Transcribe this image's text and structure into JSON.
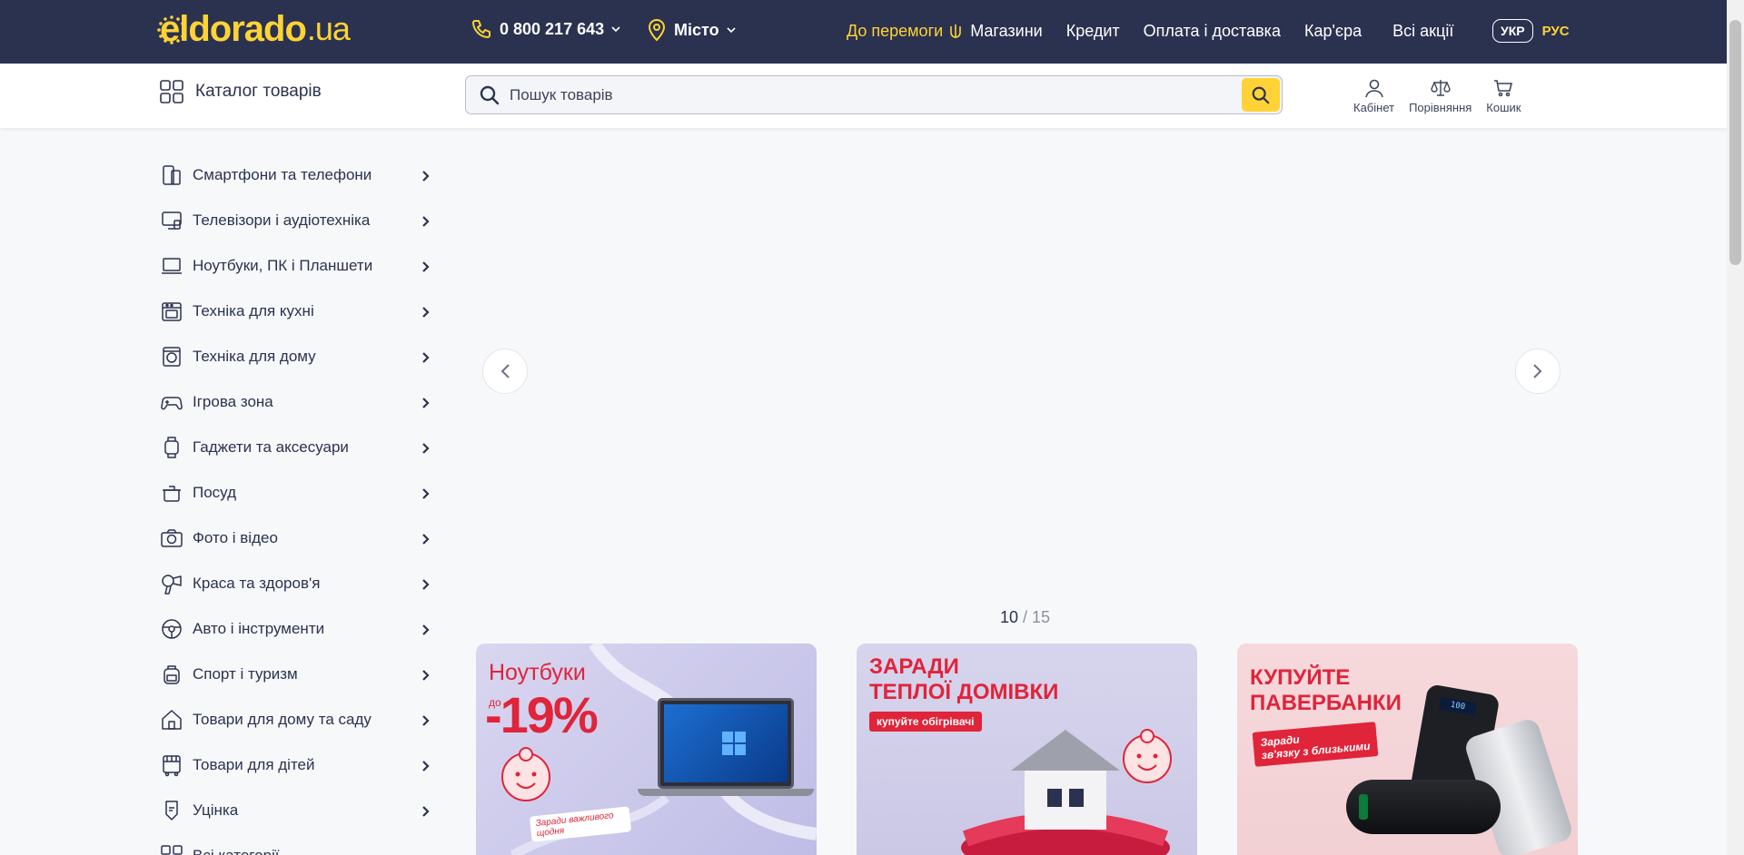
{
  "header": {
    "logo_main": "eldorado",
    "logo_suffix": ".ua",
    "phone": "0 800 217 643",
    "city": "Місто",
    "nav": {
      "victory": "До перемоги",
      "stores": "Магазини",
      "credit": "Кредит",
      "payment": "Оплата і доставка",
      "career": "Кар'єра",
      "promos": "Всі акції"
    },
    "lang_active": "УКР",
    "lang_other": "РУС"
  },
  "subbar": {
    "catalog_label": "Каталог товарів",
    "search_placeholder": "Пошук товарів",
    "cabinet": "Кабінет",
    "compare": "Порівняння",
    "cart": "Кошик"
  },
  "categories": [
    {
      "label": "Смартфони та телефони",
      "icon": "phone-icon"
    },
    {
      "label": "Телевізори і аудіотехніка",
      "icon": "tv-icon"
    },
    {
      "label": "Ноутбуки, ПК і Планшети",
      "icon": "laptop-icon"
    },
    {
      "label": "Техніка для кухні",
      "icon": "oven-icon"
    },
    {
      "label": "Техніка для дому",
      "icon": "washer-icon"
    },
    {
      "label": "Ігрова зона",
      "icon": "gamepad-icon"
    },
    {
      "label": "Гаджети та аксесуари",
      "icon": "watch-icon"
    },
    {
      "label": "Посуд",
      "icon": "pot-icon"
    },
    {
      "label": "Фото і відео",
      "icon": "camera-icon"
    },
    {
      "label": "Краса та здоров'я",
      "icon": "hairdryer-icon"
    },
    {
      "label": "Авто і інструменти",
      "icon": "steering-wheel-icon"
    },
    {
      "label": "Спорт і туризм",
      "icon": "backpack-icon"
    },
    {
      "label": "Товари для дому та саду",
      "icon": "house-icon"
    },
    {
      "label": "Товари для дітей",
      "icon": "stroller-icon"
    },
    {
      "label": "Уцінка",
      "icon": "tag-icon"
    },
    {
      "label": "Всі категорії",
      "icon": "grid-icon"
    }
  ],
  "slider": {
    "current": "10",
    "total": "/ 15"
  },
  "promos": [
    {
      "title": "Ноутбуки",
      "prefix": "до",
      "discount": "-19%",
      "note": "Заради важливого щодня"
    },
    {
      "title_line1": "ЗАРАДИ",
      "title_line2": "ТЕПЛОЇ ДОМІВКИ",
      "badge": "купуйте обігрівачі"
    },
    {
      "title_line1": "КУПУЙТЕ",
      "title_line2": "ПАВЕРБАНКИ",
      "badge_line1": "Заради",
      "badge_line2": "зв'язку з близькими"
    }
  ],
  "colors": {
    "navy": "#2b3250",
    "yellow": "#ffd335",
    "red": "#e0243a"
  }
}
